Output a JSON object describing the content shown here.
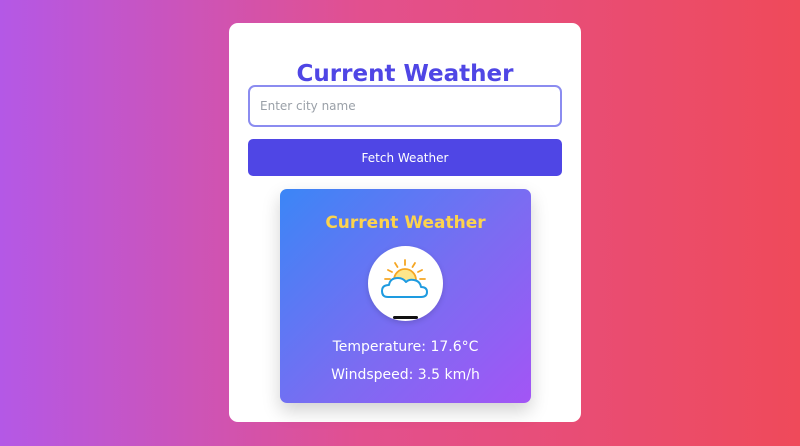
{
  "app": {
    "title": "Current Weather"
  },
  "search": {
    "placeholder": "Enter city name",
    "value": ""
  },
  "button": {
    "label": "Fetch Weather"
  },
  "weather_card": {
    "title": "Current Weather",
    "icon": "partly-cloudy-icon",
    "temperature_text": "Temperature: 17.6°C",
    "windspeed_text": "Windspeed: 3.5 km/h"
  },
  "colors": {
    "accent": "#4f46e5",
    "card_title": "#fcd34d",
    "input_border": "#8b8cf0"
  }
}
